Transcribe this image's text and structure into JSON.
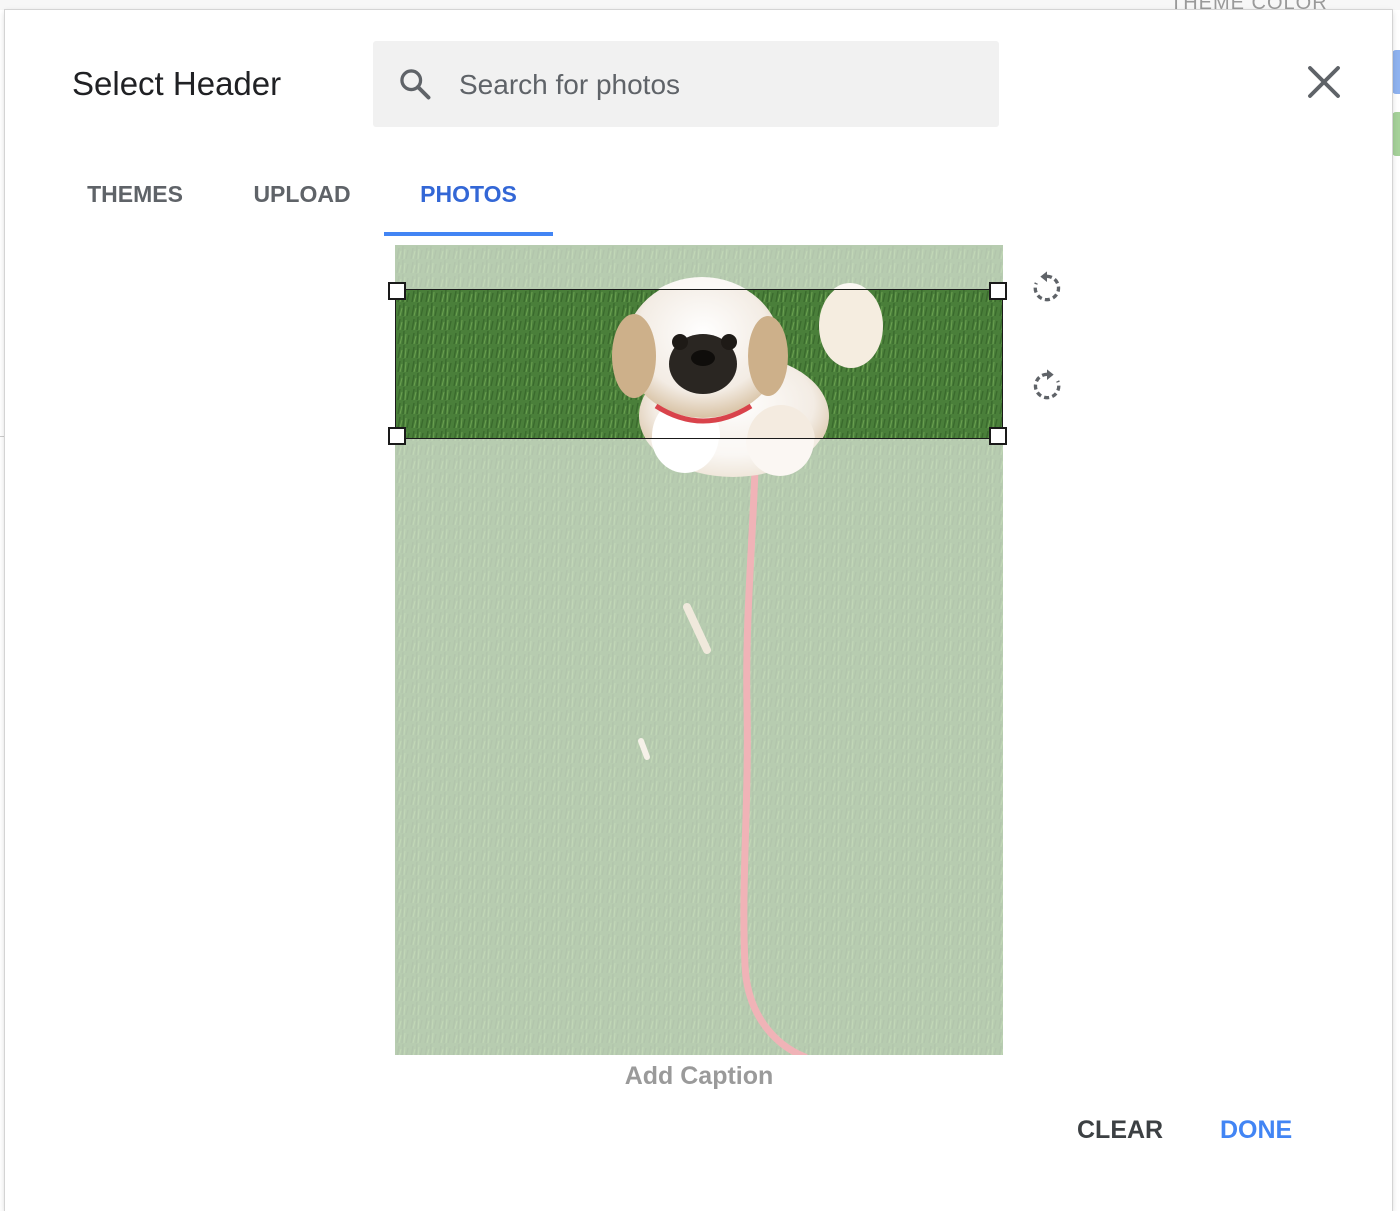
{
  "background": {
    "partial_label": "THEME COLOR"
  },
  "dialog": {
    "title": "Select Header",
    "search": {
      "placeholder": "Search for photos",
      "value": ""
    },
    "close_icon": "close-icon",
    "tabs": [
      {
        "label": "THEMES",
        "active": false
      },
      {
        "label": "UPLOAD",
        "active": false
      },
      {
        "label": "PHOTOS",
        "active": true
      }
    ],
    "photo": {
      "subject": "dog-on-grass-with-red-leash",
      "rotate_left_icon": "rotate-left-icon",
      "rotate_right_icon": "rotate-right-icon"
    },
    "caption_placeholder": "Add Caption",
    "actions": {
      "clear": "CLEAR",
      "done": "DONE"
    }
  },
  "colors": {
    "accent": "#4285f4",
    "active_tab": "#3367d6",
    "text": "#202124",
    "muted": "#5f6368"
  }
}
